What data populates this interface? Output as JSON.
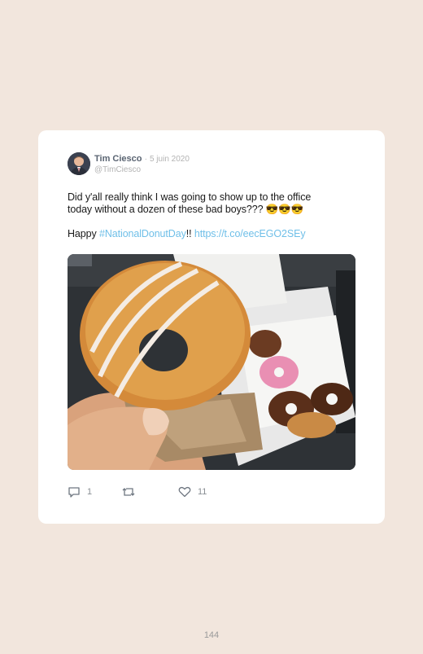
{
  "tweet": {
    "author_name": "Tim Ciesco",
    "separator": "·",
    "date": "5 juin 2020",
    "handle": "@TimCiesco",
    "text_line1": "Did y'all really think I was going to show up to the office",
    "text_line2": "today without a dozen of these bad boys??? 😎😎😎",
    "text_happy": "Happy ",
    "hashtag": "#NationalDonutDay",
    "exclaim": "!! ",
    "url": "https://t.co/eecEGO2SEy",
    "link_color": "#6fbfe8"
  },
  "actions": {
    "reply_icon": "reply-icon",
    "reply_count": "1",
    "retweet_icon": "retweet-icon",
    "like_icon": "heart-icon",
    "like_count": "11"
  },
  "footer": {
    "page_number": "144"
  }
}
